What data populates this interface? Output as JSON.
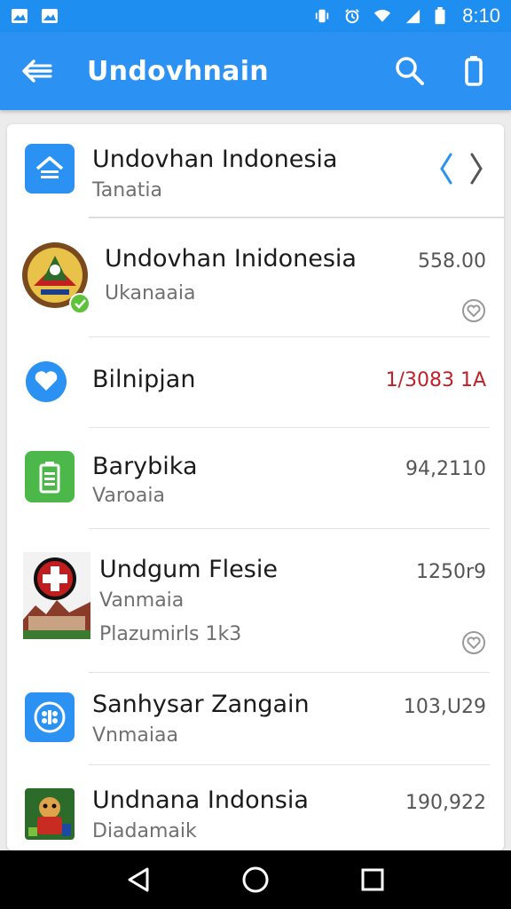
{
  "status_bar": {
    "time": "8:10",
    "left_icons": [
      "image-notification-icon",
      "image-notification-icon"
    ],
    "right_icons": [
      "vibrate-icon",
      "alarm-icon",
      "wifi-icon",
      "signal-icon",
      "battery-icon"
    ]
  },
  "app_bar": {
    "title": "Undovhnain",
    "back_icon": "arrow-back-icon",
    "actions": [
      "search-icon",
      "battery-action-icon"
    ],
    "color": "#2b92f3"
  },
  "list": {
    "header": {
      "title": "Undovhan Indonesia",
      "subtitle": "Tanatia",
      "icon": "home-icon"
    },
    "items": [
      {
        "title": "Undovhan Inidonesia",
        "subtitle": "Ukanaaia",
        "value": "558.00",
        "icon": "emblem-avatar",
        "badge": "check-badge-icon",
        "heart": true
      },
      {
        "title": "Bilnipjan",
        "subtitle": "",
        "value": "1/3083 1A",
        "value_color": "#c0202a",
        "icon": "heart-circle-icon"
      },
      {
        "title": "Barybika",
        "subtitle": "Varoaia",
        "value": "94,2110",
        "icon": "battery-square-icon"
      },
      {
        "title": "Undgum Flesie",
        "subtitle": "Vanmaia",
        "extra": "Plazumirls 1k3",
        "value": "1250r9",
        "icon": "red-cross-thumbnail",
        "heart": true
      },
      {
        "title": "Sanhysar Zangain",
        "subtitle": "Vnmaiaa",
        "value": "103,U29",
        "icon": "chip-square-icon"
      },
      {
        "title": "Undnana Indonsia",
        "subtitle": "Diadamaik",
        "value": "190,922",
        "icon": "game-thumbnail"
      }
    ]
  },
  "nav_bar": {
    "buttons": [
      "back-triangle-icon",
      "home-circle-icon",
      "recents-square-icon"
    ]
  }
}
